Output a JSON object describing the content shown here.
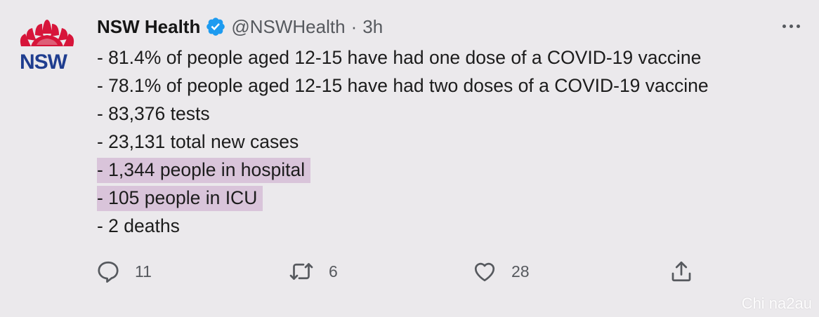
{
  "tweet": {
    "avatar": {
      "logo_text": "NSW",
      "brand_red": "#d7153a",
      "brand_blue": "#1f3d8f"
    },
    "author": {
      "display_name": "NSW Health",
      "handle": "@NSWHealth",
      "separator": "·",
      "time": "3h",
      "verified": true,
      "verified_color": "#1d9bf0"
    },
    "more_icon": "more-horizontal-icon",
    "lines": [
      {
        "text": "- 81.4% of people aged 12-15 have had one dose of a COVID-19 vaccine",
        "highlighted": false
      },
      {
        "text": "- 78.1% of people aged 12-15 have had two doses of a COVID-19 vaccine",
        "highlighted": false
      },
      {
        "text": "- 83,376 tests",
        "highlighted": false
      },
      {
        "text": "- 23,131 total new cases",
        "highlighted": false
      },
      {
        "text": "- 1,344 people in hospital",
        "highlighted": true
      },
      {
        "text": "- 105 people in ICU",
        "highlighted": true
      },
      {
        "text": "- 2 deaths",
        "highlighted": false
      }
    ],
    "highlight_color": "#d9c4da",
    "actions": {
      "reply": {
        "icon": "reply-icon",
        "count": "11"
      },
      "retweet": {
        "icon": "retweet-icon",
        "count": "6"
      },
      "like": {
        "icon": "heart-icon",
        "count": "28"
      },
      "share": {
        "icon": "share-icon"
      }
    }
  },
  "watermark": "Chi na2au"
}
